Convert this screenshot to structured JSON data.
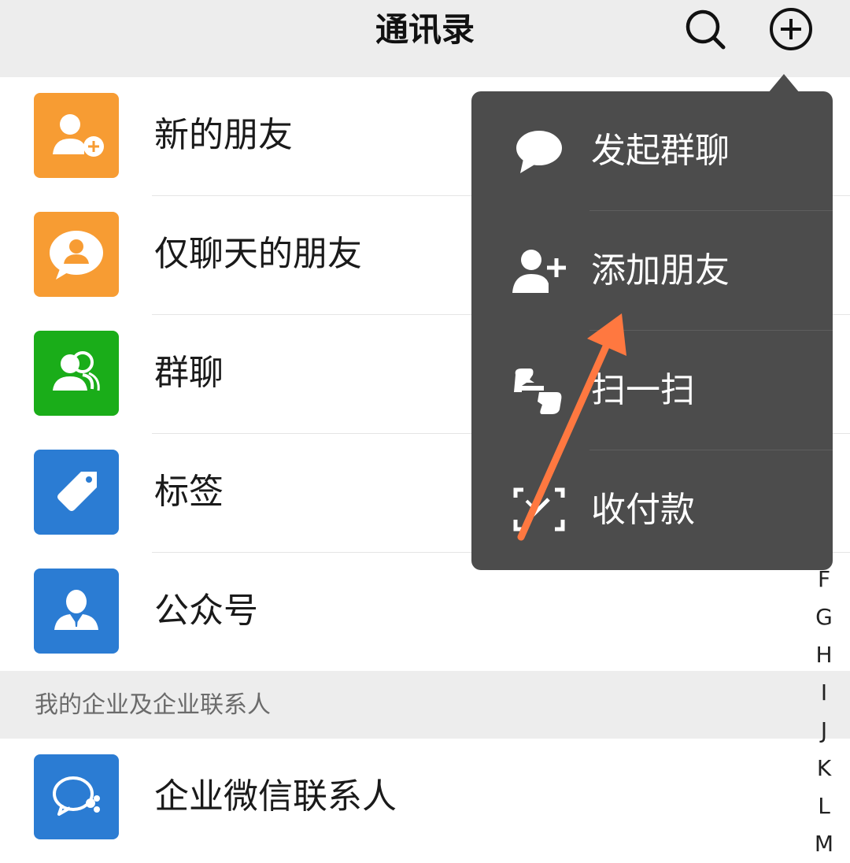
{
  "header": {
    "title": "通讯录",
    "search_icon": "search-icon",
    "add_icon": "plus-circle-icon"
  },
  "contacts": [
    {
      "label": "新的朋友",
      "icon": "add-friend-icon",
      "color": "#f79c33"
    },
    {
      "label": "仅聊天的朋友",
      "icon": "chat-only-icon",
      "color": "#f79c33"
    },
    {
      "label": "群聊",
      "icon": "group-icon",
      "color": "#1aad19"
    },
    {
      "label": "标签",
      "icon": "tag-icon",
      "color": "#2b7cd3"
    },
    {
      "label": "公众号",
      "icon": "official-account-icon",
      "color": "#2b7cd3"
    }
  ],
  "section": {
    "title": "我的企业及企业联系人"
  },
  "enterprise": {
    "label": "企业微信联系人",
    "icon": "wecom-icon",
    "color": "#2b7cd3"
  },
  "index_letters": [
    "F",
    "G",
    "H",
    "I",
    "J",
    "K",
    "L",
    "M"
  ],
  "popup_menu": {
    "items": [
      {
        "label": "发起群聊",
        "icon": "chat-bubble-icon"
      },
      {
        "label": "添加朋友",
        "icon": "add-user-icon"
      },
      {
        "label": "扫一扫",
        "icon": "scan-icon"
      },
      {
        "label": "收付款",
        "icon": "payment-scan-icon"
      }
    ]
  },
  "annotation": {
    "color": "#ff7840"
  }
}
